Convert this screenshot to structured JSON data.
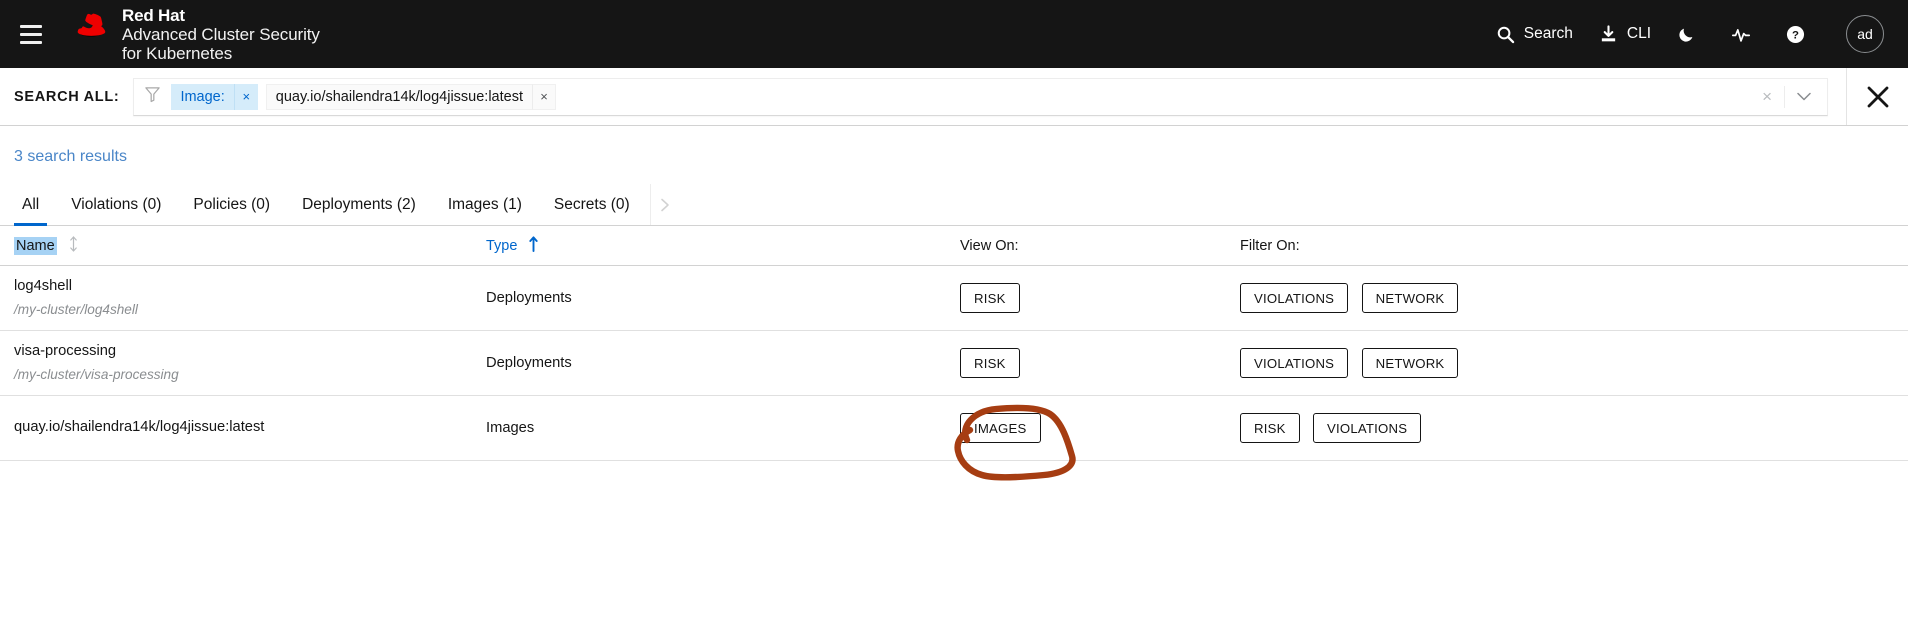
{
  "masthead": {
    "menu_icon": "hamburger-icon",
    "brand_title": "Red Hat",
    "brand_line1": "Advanced Cluster Security",
    "brand_line2": "for Kubernetes",
    "items": [
      {
        "label": "Search",
        "icon": "search-icon"
      },
      {
        "label": "CLI",
        "icon": "download-icon"
      },
      {
        "label": "",
        "icon": "moon-icon"
      },
      {
        "label": "",
        "icon": "activity-icon"
      },
      {
        "label": "",
        "icon": "help-circle-icon"
      }
    ],
    "avatar_initials": "ad",
    "background_color": "#151515"
  },
  "search": {
    "label": "SEARCH ALL:",
    "filter_icon": "funnel-icon",
    "chips": [
      {
        "key": "Image:",
        "value": "quay.io/shailendra14k/log4jissue:latest",
        "remove_label": "×"
      }
    ],
    "clear_label": "×",
    "caret_icon": "chevron-down-icon",
    "close_label": "✕",
    "chip_key_color": "#0066cc",
    "chip_key_bg": "#d5ecfa"
  },
  "results": {
    "count_text": "3 search results",
    "count_color": "#4a86c8"
  },
  "tabs": [
    {
      "label": "All",
      "active": true
    },
    {
      "label": "Violations (0)",
      "active": false
    },
    {
      "label": "Policies (0)",
      "active": false
    },
    {
      "label": "Deployments (2)",
      "active": false
    },
    {
      "label": "Images (1)",
      "active": false
    },
    {
      "label": "Secrets (0)",
      "active": false
    }
  ],
  "tab_scroll_icon": "chevron-right-icon",
  "table": {
    "headers": {
      "name": "Name",
      "name_sort": "sortable-both-icon",
      "type": "Type",
      "type_sort": "sort-ascending-icon",
      "view_on": "View On:",
      "filter_on": "Filter On:"
    },
    "rows": [
      {
        "name": "log4shell",
        "subtitle": "/my-cluster/log4shell",
        "type": "Deployments",
        "view_on": [
          "RISK"
        ],
        "filter_on": [
          "VIOLATIONS",
          "NETWORK"
        ]
      },
      {
        "name": "visa-processing",
        "subtitle": "/my-cluster/visa-processing",
        "type": "Deployments",
        "view_on": [
          "RISK"
        ],
        "filter_on": [
          "VIOLATIONS",
          "NETWORK"
        ]
      },
      {
        "name": "quay.io/shailendra14k/log4jissue:latest",
        "subtitle": "",
        "type": "Images",
        "view_on": [
          "IMAGES"
        ],
        "filter_on": [
          "RISK",
          "VIOLATIONS"
        ]
      }
    ]
  },
  "annotation": {
    "shape": "hand-drawn-circle",
    "target": "IMAGES",
    "color": "#a63d12"
  }
}
